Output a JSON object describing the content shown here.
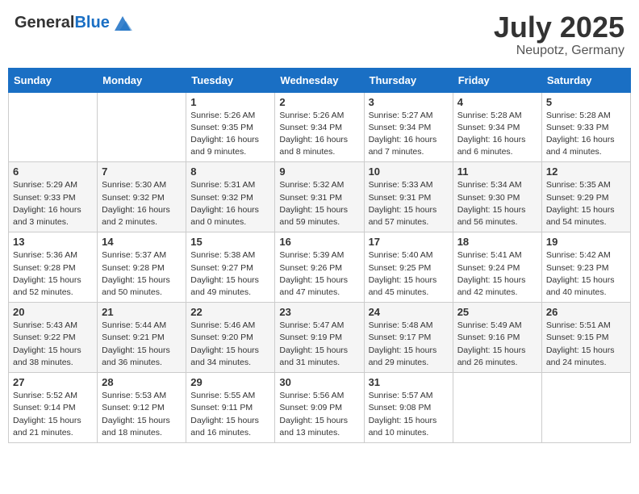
{
  "header": {
    "logo_general": "General",
    "logo_blue": "Blue",
    "month_title": "July 2025",
    "location": "Neupotz, Germany"
  },
  "weekdays": [
    "Sunday",
    "Monday",
    "Tuesday",
    "Wednesday",
    "Thursday",
    "Friday",
    "Saturday"
  ],
  "weeks": [
    [
      {
        "day": "",
        "info": ""
      },
      {
        "day": "",
        "info": ""
      },
      {
        "day": "1",
        "info": "Sunrise: 5:26 AM\nSunset: 9:35 PM\nDaylight: 16 hours and 9 minutes."
      },
      {
        "day": "2",
        "info": "Sunrise: 5:26 AM\nSunset: 9:34 PM\nDaylight: 16 hours and 8 minutes."
      },
      {
        "day": "3",
        "info": "Sunrise: 5:27 AM\nSunset: 9:34 PM\nDaylight: 16 hours and 7 minutes."
      },
      {
        "day": "4",
        "info": "Sunrise: 5:28 AM\nSunset: 9:34 PM\nDaylight: 16 hours and 6 minutes."
      },
      {
        "day": "5",
        "info": "Sunrise: 5:28 AM\nSunset: 9:33 PM\nDaylight: 16 hours and 4 minutes."
      }
    ],
    [
      {
        "day": "6",
        "info": "Sunrise: 5:29 AM\nSunset: 9:33 PM\nDaylight: 16 hours and 3 minutes."
      },
      {
        "day": "7",
        "info": "Sunrise: 5:30 AM\nSunset: 9:32 PM\nDaylight: 16 hours and 2 minutes."
      },
      {
        "day": "8",
        "info": "Sunrise: 5:31 AM\nSunset: 9:32 PM\nDaylight: 16 hours and 0 minutes."
      },
      {
        "day": "9",
        "info": "Sunrise: 5:32 AM\nSunset: 9:31 PM\nDaylight: 15 hours and 59 minutes."
      },
      {
        "day": "10",
        "info": "Sunrise: 5:33 AM\nSunset: 9:31 PM\nDaylight: 15 hours and 57 minutes."
      },
      {
        "day": "11",
        "info": "Sunrise: 5:34 AM\nSunset: 9:30 PM\nDaylight: 15 hours and 56 minutes."
      },
      {
        "day": "12",
        "info": "Sunrise: 5:35 AM\nSunset: 9:29 PM\nDaylight: 15 hours and 54 minutes."
      }
    ],
    [
      {
        "day": "13",
        "info": "Sunrise: 5:36 AM\nSunset: 9:28 PM\nDaylight: 15 hours and 52 minutes."
      },
      {
        "day": "14",
        "info": "Sunrise: 5:37 AM\nSunset: 9:28 PM\nDaylight: 15 hours and 50 minutes."
      },
      {
        "day": "15",
        "info": "Sunrise: 5:38 AM\nSunset: 9:27 PM\nDaylight: 15 hours and 49 minutes."
      },
      {
        "day": "16",
        "info": "Sunrise: 5:39 AM\nSunset: 9:26 PM\nDaylight: 15 hours and 47 minutes."
      },
      {
        "day": "17",
        "info": "Sunrise: 5:40 AM\nSunset: 9:25 PM\nDaylight: 15 hours and 45 minutes."
      },
      {
        "day": "18",
        "info": "Sunrise: 5:41 AM\nSunset: 9:24 PM\nDaylight: 15 hours and 42 minutes."
      },
      {
        "day": "19",
        "info": "Sunrise: 5:42 AM\nSunset: 9:23 PM\nDaylight: 15 hours and 40 minutes."
      }
    ],
    [
      {
        "day": "20",
        "info": "Sunrise: 5:43 AM\nSunset: 9:22 PM\nDaylight: 15 hours and 38 minutes."
      },
      {
        "day": "21",
        "info": "Sunrise: 5:44 AM\nSunset: 9:21 PM\nDaylight: 15 hours and 36 minutes."
      },
      {
        "day": "22",
        "info": "Sunrise: 5:46 AM\nSunset: 9:20 PM\nDaylight: 15 hours and 34 minutes."
      },
      {
        "day": "23",
        "info": "Sunrise: 5:47 AM\nSunset: 9:19 PM\nDaylight: 15 hours and 31 minutes."
      },
      {
        "day": "24",
        "info": "Sunrise: 5:48 AM\nSunset: 9:17 PM\nDaylight: 15 hours and 29 minutes."
      },
      {
        "day": "25",
        "info": "Sunrise: 5:49 AM\nSunset: 9:16 PM\nDaylight: 15 hours and 26 minutes."
      },
      {
        "day": "26",
        "info": "Sunrise: 5:51 AM\nSunset: 9:15 PM\nDaylight: 15 hours and 24 minutes."
      }
    ],
    [
      {
        "day": "27",
        "info": "Sunrise: 5:52 AM\nSunset: 9:14 PM\nDaylight: 15 hours and 21 minutes."
      },
      {
        "day": "28",
        "info": "Sunrise: 5:53 AM\nSunset: 9:12 PM\nDaylight: 15 hours and 18 minutes."
      },
      {
        "day": "29",
        "info": "Sunrise: 5:55 AM\nSunset: 9:11 PM\nDaylight: 15 hours and 16 minutes."
      },
      {
        "day": "30",
        "info": "Sunrise: 5:56 AM\nSunset: 9:09 PM\nDaylight: 15 hours and 13 minutes."
      },
      {
        "day": "31",
        "info": "Sunrise: 5:57 AM\nSunset: 9:08 PM\nDaylight: 15 hours and 10 minutes."
      },
      {
        "day": "",
        "info": ""
      },
      {
        "day": "",
        "info": ""
      }
    ]
  ]
}
